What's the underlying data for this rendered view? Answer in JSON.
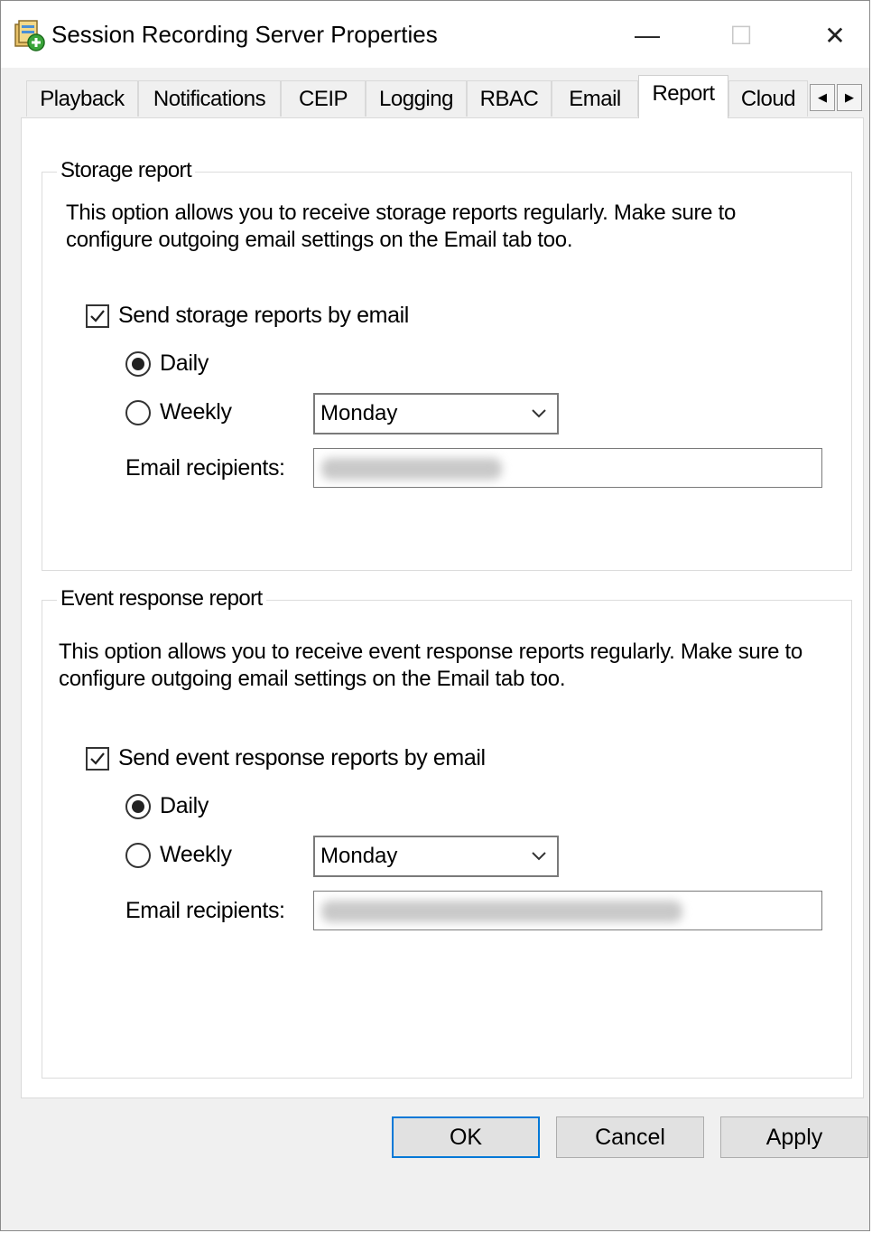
{
  "window": {
    "title": "Session Recording Server Properties",
    "controls": {
      "minimize": "—",
      "maximize": "☐",
      "close": "✕"
    }
  },
  "tabs": [
    {
      "label": "Playback"
    },
    {
      "label": "Notifications"
    },
    {
      "label": "CEIP"
    },
    {
      "label": "Logging"
    },
    {
      "label": "RBAC"
    },
    {
      "label": "Email"
    },
    {
      "label": "Report",
      "active": true
    },
    {
      "label": "Cloud"
    }
  ],
  "tab_scroll": {
    "left": "◀",
    "right": "▶"
  },
  "storage_report": {
    "title": "Storage report",
    "description": "This option allows you to receive storage reports regularly. Make sure to configure outgoing email settings on the Email tab too.",
    "send_checkbox_label": "Send storage reports by email",
    "send_checked": true,
    "daily_label": "Daily",
    "weekly_label": "Weekly",
    "frequency_selected": "Daily",
    "weekday_value": "Monday",
    "recipients_label": "Email recipients:"
  },
  "event_response_report": {
    "title": "Event response report",
    "description": "This option allows you to receive event response reports regularly. Make sure to configure outgoing email settings on the Email tab too.",
    "send_checkbox_label": "Send event response reports by email",
    "send_checked": true,
    "daily_label": "Daily",
    "weekly_label": "Weekly",
    "frequency_selected": "Daily",
    "weekday_value": "Monday",
    "recipients_label": "Email recipients:"
  },
  "buttons": {
    "ok": "OK",
    "cancel": "Cancel",
    "apply": "Apply"
  },
  "colors": {
    "accent": "#0078d7",
    "dialog_bg": "#f0f0f0",
    "panel_bg": "#ffffff"
  }
}
